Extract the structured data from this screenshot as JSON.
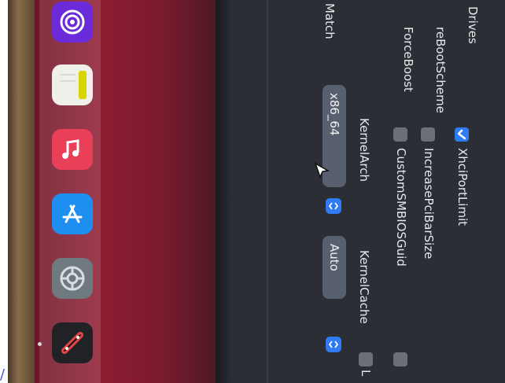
{
  "left_labels": [
    "Drives",
    "reBootScheme",
    "ForceBoost",
    "Match"
  ],
  "checkboxes": [
    {
      "label": "XhciPortLimit",
      "checked": true
    },
    {
      "label": "IncreasePciBarSize",
      "checked": false
    },
    {
      "label": "CustomSMBIOSGuid",
      "checked": false
    }
  ],
  "kernel": {
    "arch_label": "KernelArch",
    "arch_value": "x86_64",
    "cache_label": "KernelCache",
    "cache_value": "Auto"
  },
  "partial_text": "L",
  "footer_char": "/",
  "dock": {
    "apps": [
      "podcasts-icon",
      "notes-icon",
      "music-icon",
      "app-store-icon",
      "system-settings-icon",
      "tool-icon"
    ]
  },
  "colors": {
    "accent": "#2f7bf1",
    "panel": "#2b2e35",
    "wallpaper": "#8f1d33"
  }
}
